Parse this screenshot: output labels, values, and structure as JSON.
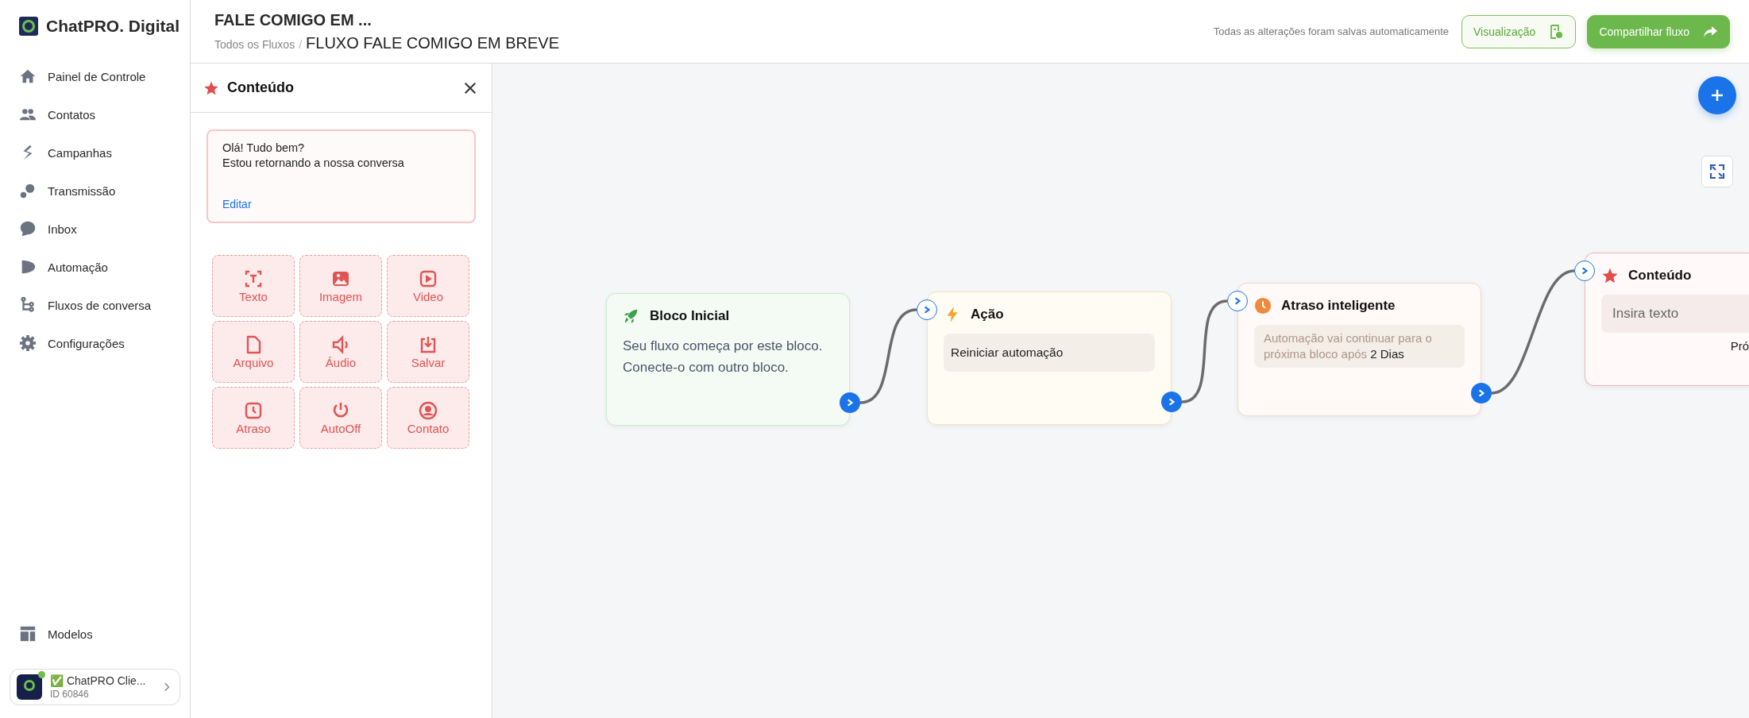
{
  "brand": {
    "name": "ChatPRO. Digital"
  },
  "nav": [
    {
      "label": "Painel de Controle"
    },
    {
      "label": "Contatos"
    },
    {
      "label": "Campanhas"
    },
    {
      "label": "Transmissão"
    },
    {
      "label": "Inbox"
    },
    {
      "label": "Automação"
    },
    {
      "label": "Fluxos de conversa"
    },
    {
      "label": "Configurações"
    }
  ],
  "nav_bottom": {
    "label": "Modelos"
  },
  "account": {
    "name": "✅ ChatPRO Clie...",
    "id": "ID 60846",
    "online": true
  },
  "header": {
    "title": "FALE COMIGO EM ...",
    "breadcrumb": "Todos os Fluxos",
    "separator": "/",
    "current": "FLUXO FALE COMIGO EM BREVE",
    "save_status": "Todas as alterações foram salvas automaticamente",
    "buttons": [
      {
        "label": "Visualização",
        "kind": "outline"
      },
      {
        "label": "Compartilhar fluxo",
        "kind": "primary"
      }
    ]
  },
  "panel": {
    "title": "Conteúdo",
    "message": [
      "Olá! Tudo bem?",
      "Estou retornando a nossa conversa"
    ],
    "edit_link": "Editar",
    "tools": [
      {
        "label": "Texto"
      },
      {
        "label": "Imagem"
      },
      {
        "label": "Video"
      },
      {
        "label": "Arquivo"
      },
      {
        "label": "Áudio"
      },
      {
        "label": "Salvar"
      },
      {
        "label": "Atraso"
      },
      {
        "label": "AutoOff"
      },
      {
        "label": "Contato"
      }
    ]
  },
  "nodes": [
    {
      "kind": "start",
      "title": "Bloco Inicial",
      "text": "Seu fluxo começa por este bloco. Conecte-o com outro bloco."
    },
    {
      "kind": "action",
      "title": "Ação",
      "value": "Reiniciar automação"
    },
    {
      "kind": "delay",
      "title": "Atraso inteligente",
      "text": "Automação vai continuar para o próxima bloco após",
      "value": "2 Dias"
    },
    {
      "kind": "content",
      "title": "Conteúdo",
      "placeholder": "Insira texto",
      "footer": "Pró"
    }
  ]
}
